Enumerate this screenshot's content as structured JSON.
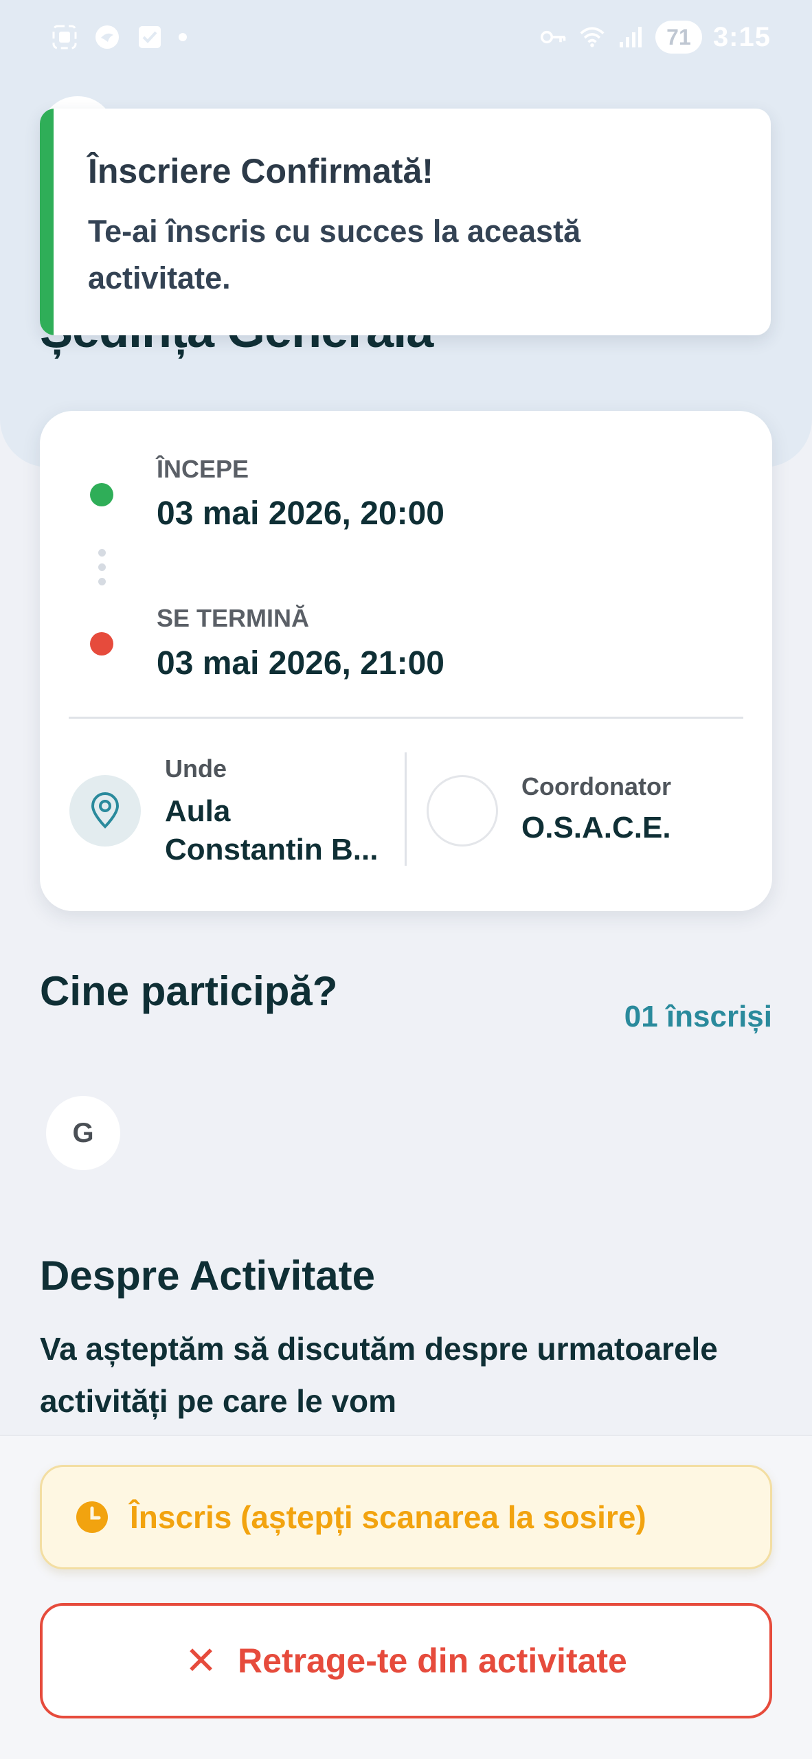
{
  "status_bar": {
    "battery": "71",
    "time": "3:15",
    "icons": [
      "screenshot-icon",
      "bird-icon",
      "check-icon",
      "dot-icon",
      "key-icon",
      "wifi-icon",
      "signal-icon"
    ]
  },
  "page": {
    "title": "Ședința Generală"
  },
  "toast": {
    "title": "Înscriere Confirmată!",
    "message": "Te-ai înscris cu succes la această activitate.",
    "accent": "#2fae58"
  },
  "schedule": {
    "start_label": "ÎNCEPE",
    "start_value": "03 mai 2026, 20:00",
    "end_label": "SE TERMINĂ",
    "end_value": "03 mai 2026, 21:00"
  },
  "location": {
    "label": "Unde",
    "value": "Aula Constantin B..."
  },
  "coordinator": {
    "label": "Coordonator",
    "value": "O.S.A.C.E."
  },
  "participants": {
    "title": "Cine participă?",
    "count": "01 înscriși",
    "avatars": [
      "G"
    ]
  },
  "about": {
    "title": "Despre Activitate",
    "text": "Va așteptăm să discutăm despre urmatoarele activități pe care le vom"
  },
  "registration": {
    "status": "Înscris (aștepți scanarea la sosire)",
    "withdraw_label": "Retrage-te din activitate",
    "status_color": "#f2a30f",
    "danger_color": "#e64b3c"
  }
}
